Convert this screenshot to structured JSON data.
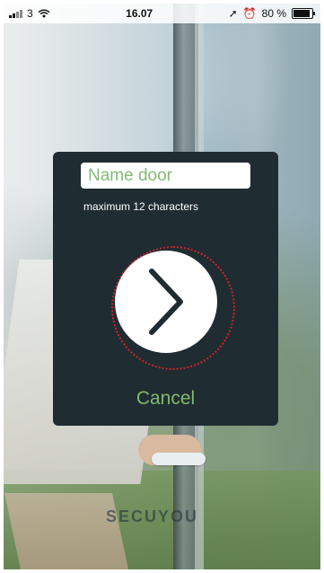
{
  "status_bar": {
    "carrier": "3",
    "time": "16.07",
    "battery_percent": "80 %"
  },
  "dialog": {
    "input_placeholder": "Name door",
    "hint": "maximum 12 characters",
    "cancel_label": "Cancel"
  },
  "background": {
    "brand_text": "SECUYOU"
  },
  "colors": {
    "accent_green": "#83b86c",
    "dialog_bg": "#1f2c32",
    "ring_red": "#d0242a"
  },
  "icons": {
    "next": "chevron-right-icon"
  }
}
